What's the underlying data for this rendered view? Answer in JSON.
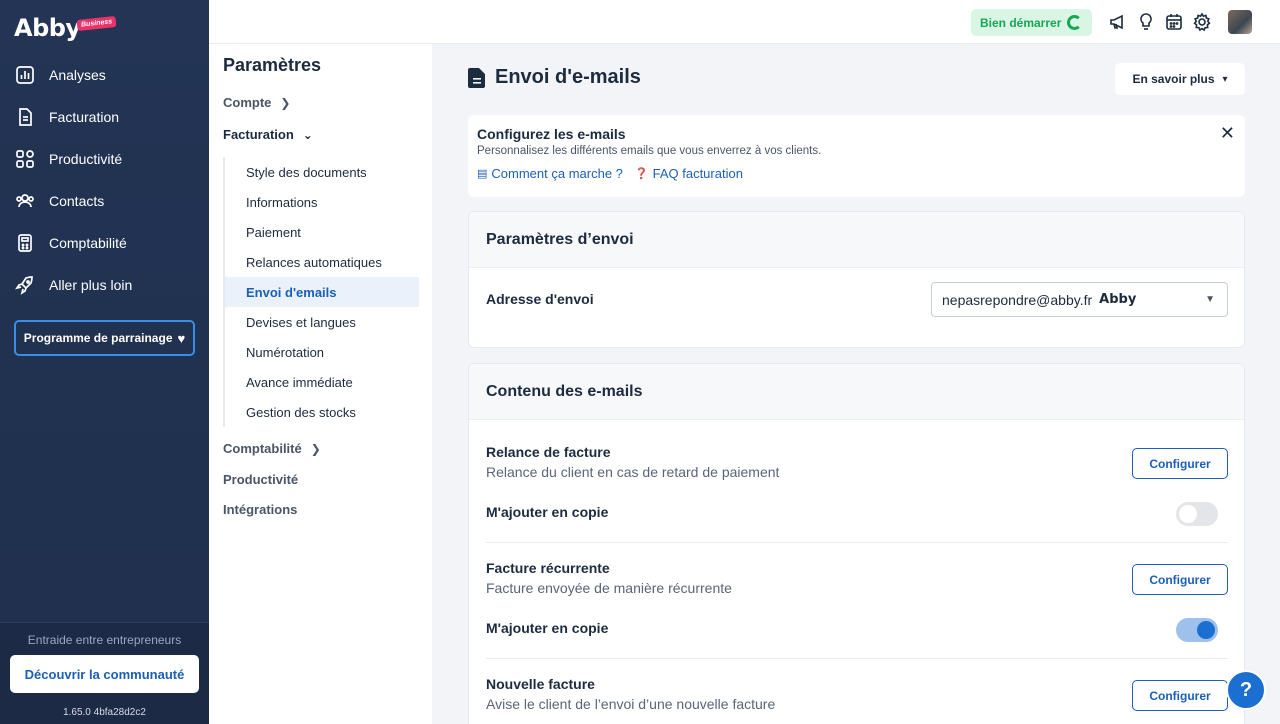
{
  "brand": {
    "logo": "Abby",
    "badge": "Business"
  },
  "sidebar": {
    "items": [
      {
        "label": "Analyses",
        "icon": "chart-icon"
      },
      {
        "label": "Facturation",
        "icon": "document-icon"
      },
      {
        "label": "Productivité",
        "icon": "grid-icon"
      },
      {
        "label": "Contacts",
        "icon": "users-icon"
      },
      {
        "label": "Comptabilité",
        "icon": "calculator-icon"
      },
      {
        "label": "Aller plus loin",
        "icon": "rocket-icon"
      }
    ],
    "referral": "Programme de parrainage",
    "community_label": "Entraide entre entrepreneurs",
    "community_button": "Découvrir la communauté",
    "version": "1.65.0 4bfa28d2c2"
  },
  "topbar": {
    "start_label": "Bien démarrer"
  },
  "settings": {
    "title": "Paramètres",
    "compte": "Compte",
    "facturation": "Facturation",
    "subitems": [
      "Style des documents",
      "Informations",
      "Paiement",
      "Relances automatiques",
      "Envoi d'emails",
      "Devises et langues",
      "Numérotation",
      "Avance immédiate",
      "Gestion des stocks"
    ],
    "comptabilite": "Comptabilité",
    "productivite": "Productivité",
    "integrations": "Intégrations"
  },
  "main": {
    "title": "Envoi d'e-mails",
    "learn_more": "En savoir plus",
    "info": {
      "title": "Configurez les e-mails",
      "desc": "Personnalisez les différents emails que vous enverrez à vos clients.",
      "link1": "Comment ça marche ?",
      "link2": "FAQ facturation"
    },
    "send_params": {
      "header": "Paramètres d’envoi",
      "address_label": "Adresse d'envoi",
      "address_value": "nepasrepondre@abby.fr",
      "address_brand": "Abby"
    },
    "content": {
      "header": "Contenu des e-mails",
      "configure": "Configurer",
      "copy_label": "M'ajouter en copie",
      "items": [
        {
          "title": "Relance de facture",
          "desc": "Relance du client en cas de retard de paiement",
          "copy": false
        },
        {
          "title": "Facture récurrente",
          "desc": "Facture envoyée de manière récurrente",
          "copy": true
        },
        {
          "title": "Nouvelle facture",
          "desc": "Avise le client de l’envoi d’une nouvelle facture"
        }
      ]
    }
  },
  "help": "?"
}
